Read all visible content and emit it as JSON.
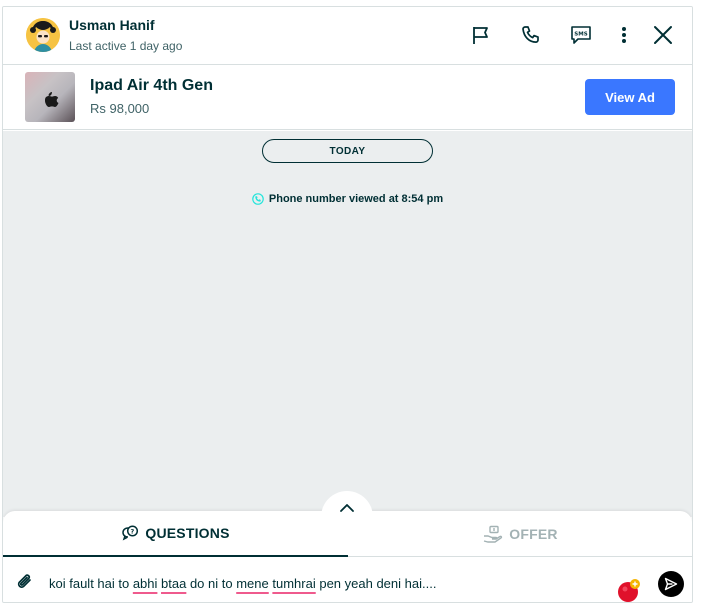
{
  "header": {
    "user_name": "Usman Hanif",
    "last_active": "Last active 1 day ago",
    "icons": [
      "flag-icon",
      "phone-icon",
      "sms-icon",
      "more-vertical-icon",
      "close-icon"
    ]
  },
  "ad": {
    "title": "Ipad Air 4th Gen",
    "price": "Rs 98,000",
    "view_button": "View Ad"
  },
  "chat": {
    "date_label": "TODAY",
    "system_message": "Phone number viewed at 8:54 pm"
  },
  "tabs": {
    "questions": "QUESTIONS",
    "offer": "OFFER",
    "active": "questions"
  },
  "composer": {
    "text_parts": [
      "koi fault hai to ",
      "abhi",
      " ",
      "btaa",
      " do ni to ",
      "mene",
      " ",
      "tumhrai",
      " pen yeah deni hai...."
    ]
  },
  "colors": {
    "accent": "#3a77ff",
    "text": "#002f34",
    "chat_bg": "#ebeeef",
    "spell_underline": "#ef5a8d",
    "system_icon": "#23e5db"
  }
}
